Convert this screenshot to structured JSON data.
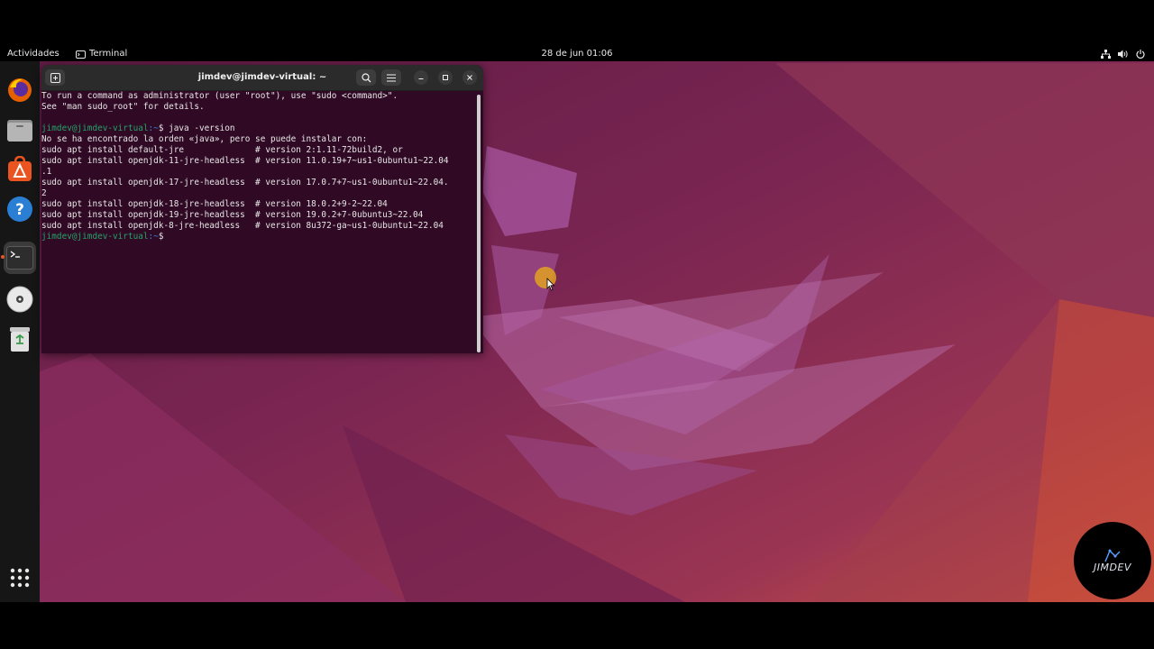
{
  "topbar": {
    "activities_label": "Actividades",
    "app_menu_label": "Terminal",
    "clock": "28 de jun  01:06",
    "tray_icons": [
      "network-icon",
      "volume-icon",
      "power-icon"
    ]
  },
  "dock": {
    "items": [
      {
        "name": "firefox",
        "icon": "firefox-icon"
      },
      {
        "name": "files",
        "icon": "files-icon"
      },
      {
        "name": "ubuntu-software",
        "icon": "software-icon"
      },
      {
        "name": "help",
        "icon": "help-icon"
      },
      {
        "name": "terminal",
        "icon": "terminal-icon",
        "active": true
      },
      {
        "name": "disc",
        "icon": "disc-icon"
      },
      {
        "name": "trash",
        "icon": "trash-icon"
      }
    ],
    "show_apps_icon": "app-grid-icon"
  },
  "terminal": {
    "title": "jimdev@jimdev-virtual: ~",
    "lines": [
      {
        "type": "text",
        "text": "To run a command as administrator (user \"root\"), use \"sudo <command>\"."
      },
      {
        "type": "text",
        "text": "See \"man sudo_root\" for details."
      },
      {
        "type": "text",
        "text": ""
      },
      {
        "type": "prompt",
        "user": "jimdev@jimdev-virtual",
        "path": ":~",
        "cmd": "$ java -version"
      },
      {
        "type": "text",
        "text": "No se ha encontrado la orden «java», pero se puede instalar con:"
      },
      {
        "type": "text",
        "text": "sudo apt install default-jre              # version 2:1.11-72build2, or"
      },
      {
        "type": "text",
        "text": "sudo apt install openjdk-11-jre-headless  # version 11.0.19+7~us1-0ubuntu1~22.04"
      },
      {
        "type": "text",
        "text": ".1"
      },
      {
        "type": "text",
        "text": "sudo apt install openjdk-17-jre-headless  # version 17.0.7+7~us1-0ubuntu1~22.04."
      },
      {
        "type": "text",
        "text": "2"
      },
      {
        "type": "text",
        "text": "sudo apt install openjdk-18-jre-headless  # version 18.0.2+9-2~22.04"
      },
      {
        "type": "text",
        "text": "sudo apt install openjdk-19-jre-headless  # version 19.0.2+7-0ubuntu3~22.04"
      },
      {
        "type": "text",
        "text": "sudo apt install openjdk-8-jre-headless   # version 8u372-ga~us1-0ubuntu1~22.04"
      },
      {
        "type": "prompt",
        "user": "jimdev@jimdev-virtual",
        "path": ":~",
        "cmd": "$ "
      }
    ]
  },
  "watermark": {
    "text": "JIMDEV"
  },
  "colors": {
    "accent": "#e95420",
    "terminal_bg": "#300a24",
    "prompt_user": "#26a269",
    "prompt_path": "#3584e4"
  }
}
